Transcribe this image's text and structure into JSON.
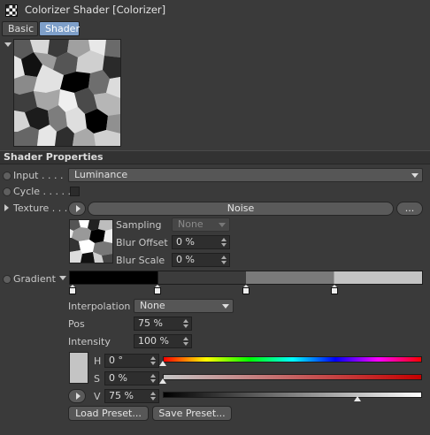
{
  "window": {
    "title": "Colorizer Shader [Colorizer]"
  },
  "tabs": [
    {
      "label": "Basic",
      "active": false
    },
    {
      "label": "Shader",
      "active": true
    }
  ],
  "section": {
    "title": "Shader Properties"
  },
  "input": {
    "label": "Input . . . .",
    "value": "Luminance"
  },
  "cycle": {
    "label": "Cycle . . . . .",
    "checked": false
  },
  "texture": {
    "label": "Texture . . .",
    "shader_name": "Noise",
    "more_label": "...",
    "sampling_label": "Sampling",
    "sampling_value": "None",
    "blur_offset_label": "Blur Offset",
    "blur_offset_value": "0 %",
    "blur_scale_label": "Blur Scale",
    "blur_scale_value": "0 %"
  },
  "gradient": {
    "label": "Gradient",
    "interpolation_label": "Interpolation",
    "interpolation_value": "None",
    "pos_label": "Pos",
    "pos_value": "75 %",
    "intensity_label": "Intensity",
    "intensity_value": "100 %",
    "stops": [
      {
        "pos": 0.0,
        "color": "#000000"
      },
      {
        "pos": 0.25,
        "color": "#3c3c3c"
      },
      {
        "pos": 0.5,
        "color": "#7a7a7a"
      },
      {
        "pos": 0.75,
        "color": "#c4c4c4"
      }
    ]
  },
  "hsv": {
    "swatch_color": "#c4c4c4",
    "h_label": "H",
    "h_value": "0 °",
    "h_level": 0,
    "s_label": "S",
    "s_value": "0 %",
    "s_level": 0,
    "v_label": "V",
    "v_value": "75 %",
    "v_level": 0.75
  },
  "buttons": {
    "load_preset": "Load Preset...",
    "save_preset": "Save Preset..."
  },
  "colors": {
    "accent": "#7e9fc9",
    "background": "#3a3a3a"
  }
}
